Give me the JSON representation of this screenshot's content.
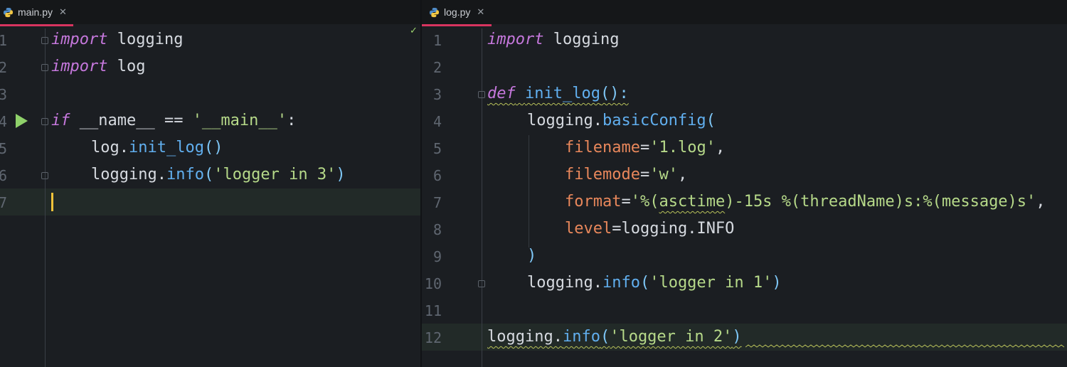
{
  "left_tab": {
    "name": "main.py",
    "close": "✕"
  },
  "right_tab": {
    "name": "log.py",
    "close": "✕"
  },
  "status_check": "✓",
  "left_editor": {
    "line_numbers": [
      "1",
      "2",
      "3",
      "4",
      "5",
      "6",
      "7"
    ],
    "lines": {
      "l1": {
        "kw": "import",
        "rest": " logging"
      },
      "l2": {
        "kw": "import",
        "rest": " log"
      },
      "l4": {
        "kw": "if",
        "a": " __name__ == ",
        "s": "'__main__'",
        "b": ":"
      },
      "l5": {
        "obj": "log.",
        "fn": "init_log",
        "p": "()"
      },
      "l6": {
        "obj": "logging.",
        "fn": "info",
        "po": "(",
        "s": "'logger in 3'",
        "pc": ")"
      }
    }
  },
  "right_editor": {
    "line_numbers": [
      "1",
      "2",
      "3",
      "4",
      "5",
      "6",
      "7",
      "8",
      "9",
      "10",
      "11",
      "12"
    ],
    "lines": {
      "r1": {
        "kw": "import",
        "rest": " logging"
      },
      "r3": {
        "kw": "def",
        "sp": " ",
        "fn": "init_log",
        "p": "():"
      },
      "r4": {
        "obj": "logging.",
        "fn": "basicConfig",
        "p": "("
      },
      "r5": {
        "param": "filename",
        "eq": "=",
        "s": "'1.log'",
        "c": ","
      },
      "r6": {
        "param": "filemode",
        "eq": "=",
        "s": "'w'",
        "c": ","
      },
      "r7": {
        "param": "format",
        "eq": "=",
        "s1": "'%(",
        "s2": "asctime",
        "s3": ")-15s %(threadName)s:%(message)s'",
        "c": ","
      },
      "r8": {
        "param": "level",
        "eq": "=",
        "rest": "logging.INFO"
      },
      "r9": {
        "p": ")"
      },
      "r10": {
        "obj": "logging.",
        "fn": "info",
        "po": "(",
        "s": "'logger in 1'",
        "pc": ")"
      },
      "r12": {
        "obj": "logging.",
        "fn": "info",
        "po": "(",
        "s": "'logger in 2'",
        "pc": ")"
      }
    }
  }
}
